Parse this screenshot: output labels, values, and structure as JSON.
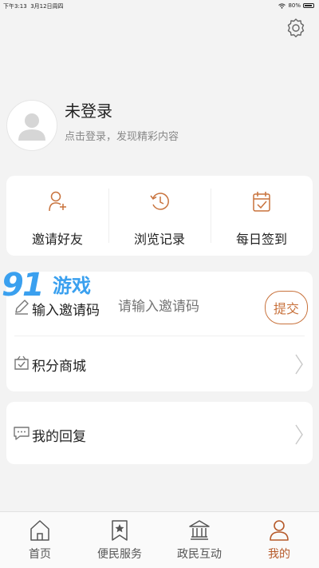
{
  "status_bar": {
    "time": "下午3:13",
    "date": "3月12日周四",
    "battery": "80%"
  },
  "profile": {
    "name": "未登录",
    "hint": "点击登录，发现精彩内容"
  },
  "quick_actions": [
    {
      "label": "邀请好友",
      "icon": "add-user-icon"
    },
    {
      "label": "浏览记录",
      "icon": "history-icon"
    },
    {
      "label": "每日签到",
      "icon": "calendar-check-icon"
    }
  ],
  "invite": {
    "label": "输入邀请码",
    "placeholder": "请输入邀请码",
    "submit": "提交"
  },
  "menu": {
    "points_mall": "积分商城",
    "my_replies": "我的回复"
  },
  "watermark": {
    "number": "91",
    "text": "游戏"
  },
  "tabs": [
    {
      "label": "首页",
      "icon": "home-icon"
    },
    {
      "label": "便民服务",
      "icon": "bookmark-star-icon"
    },
    {
      "label": "政民互动",
      "icon": "government-building-icon"
    },
    {
      "label": "我的",
      "icon": "user-icon",
      "active": true
    }
  ],
  "colors": {
    "accent": "#b65a2a",
    "icon_orange": "#c8723c",
    "background": "#f3f3f3"
  }
}
